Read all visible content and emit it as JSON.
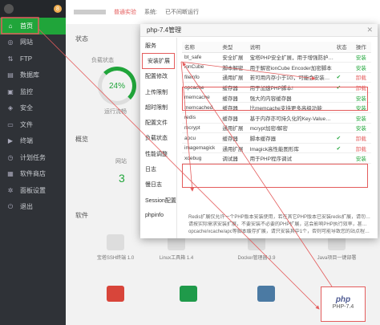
{
  "sidebar": {
    "badge": "8",
    "items": [
      {
        "label": "首页",
        "icon": "home-icon",
        "glyph": "⌂",
        "active": true
      },
      {
        "label": "网站",
        "icon": "globe-icon",
        "glyph": "◎"
      },
      {
        "label": "FTP",
        "icon": "ftp-icon",
        "glyph": "⇅"
      },
      {
        "label": "数据库",
        "icon": "database-icon",
        "glyph": "▤"
      },
      {
        "label": "监控",
        "icon": "monitor-icon",
        "glyph": "▣"
      },
      {
        "label": "安全",
        "icon": "shield-icon",
        "glyph": "◈"
      },
      {
        "label": "文件",
        "icon": "folder-icon",
        "glyph": "▭"
      },
      {
        "label": "终端",
        "icon": "terminal-icon",
        "glyph": "▶"
      },
      {
        "label": "计划任务",
        "icon": "clock-icon",
        "glyph": "◷"
      },
      {
        "label": "软件商店",
        "icon": "store-icon",
        "glyph": "▦"
      },
      {
        "label": "面板设置",
        "icon": "gear-icon",
        "glyph": "✲"
      },
      {
        "label": "退出",
        "icon": "logout-icon",
        "glyph": "⏻"
      }
    ]
  },
  "topbar": {
    "tag": "普通实验",
    "system": "系统:",
    "status": "已不间断运行"
  },
  "main": {
    "status_title": "状态",
    "load_label": "负载状态",
    "gauge_value": "24%",
    "gauge_caption": "运行流畅",
    "overview_title": "概览",
    "site_label": "网站",
    "site_count": "3",
    "software_title": "软件",
    "softs": [
      "宝塔SSH终端 1.0",
      "Linux工具箱 1.4",
      "Docker管理器 3.9",
      "Java项目一键部署"
    ]
  },
  "modal": {
    "title": "php-7.4管理",
    "close": "✕",
    "nav": [
      "服务",
      "安装扩展",
      "配置修改",
      "上传限制",
      "超时限制",
      "配置文件",
      "负载状态",
      "性能调整",
      "日志",
      "慢日志",
      "Session配置",
      "phpinfo"
    ],
    "active_nav_index": 1,
    "table": {
      "headers": [
        "名称",
        "类型",
        "说明",
        "状态",
        "操作"
      ],
      "rows": [
        {
          "name": "bt_safe",
          "type": "安全扩展",
          "desc": "宝塔PHP安全扩展，用于增强防护能力",
          "status": "",
          "op": "安装",
          "op_type": "install"
        },
        {
          "name": "ionCube",
          "type": "脚本解密",
          "desc": "用于解密ionCube Encoder加密脚本",
          "status": "",
          "op": "安装",
          "op_type": "install"
        },
        {
          "name": "fileinfo",
          "type": "通用扩展",
          "desc": "若可用内存小于1G，可能会安装不上",
          "status": "✔",
          "op": "卸载",
          "op_type": "uninstall"
        },
        {
          "name": "opcache",
          "type": "缓存器",
          "desc": "用于加速PHP脚本!",
          "status": "✔",
          "op": "卸载",
          "op_type": "uninstall"
        },
        {
          "name": "memcache",
          "type": "缓存器",
          "desc": "强大的内容缓存器",
          "status": "",
          "op": "安装",
          "op_type": "install"
        },
        {
          "name": "memcached",
          "type": "缓存器",
          "desc": "比memcache支持更多高级功能",
          "status": "",
          "op": "安装",
          "op_type": "install"
        },
        {
          "name": "redis",
          "type": "缓存器",
          "desc": "基于内存亦可持久化的Key-Value数据库",
          "status": "",
          "op": "安装",
          "op_type": "install"
        },
        {
          "name": "mcrypt",
          "type": "通用扩展",
          "desc": "mcrypt加密/解密",
          "status": "",
          "op": "安装",
          "op_type": "install"
        },
        {
          "name": "apcu",
          "type": "缓存器",
          "desc": "脚本缓存器",
          "status": "✔",
          "op": "卸载",
          "op_type": "uninstall"
        },
        {
          "name": "imagemagick",
          "type": "通用扩展",
          "desc": "Imagick高性能图形库",
          "status": "✔",
          "op": "卸载",
          "op_type": "uninstall"
        },
        {
          "name": "xdebug",
          "type": "调试器",
          "desc": "用于PHP程序调试",
          "status": "",
          "op": "安装",
          "op_type": "install"
        }
      ]
    },
    "notes": [
      "Redis扩展仅允许一个PHP版本安装使用，若在其它PHP版本已安装redis扩展，请勿再装",
      "请按实际需求安装扩展，不要安装不必要的PHP扩展，这会影响PHP执行效率，甚至出现异常",
      "opcache/xcache/apc等脚本缓存扩展，请只安装其中1个，否则可能导致您的站点程序异常"
    ]
  },
  "php_tile": {
    "logo": "php",
    "label": "PHP-7.4"
  },
  "colors": {
    "accent": "#20a53a",
    "danger": "#e45c5c",
    "sidebar": "#2f3237"
  }
}
